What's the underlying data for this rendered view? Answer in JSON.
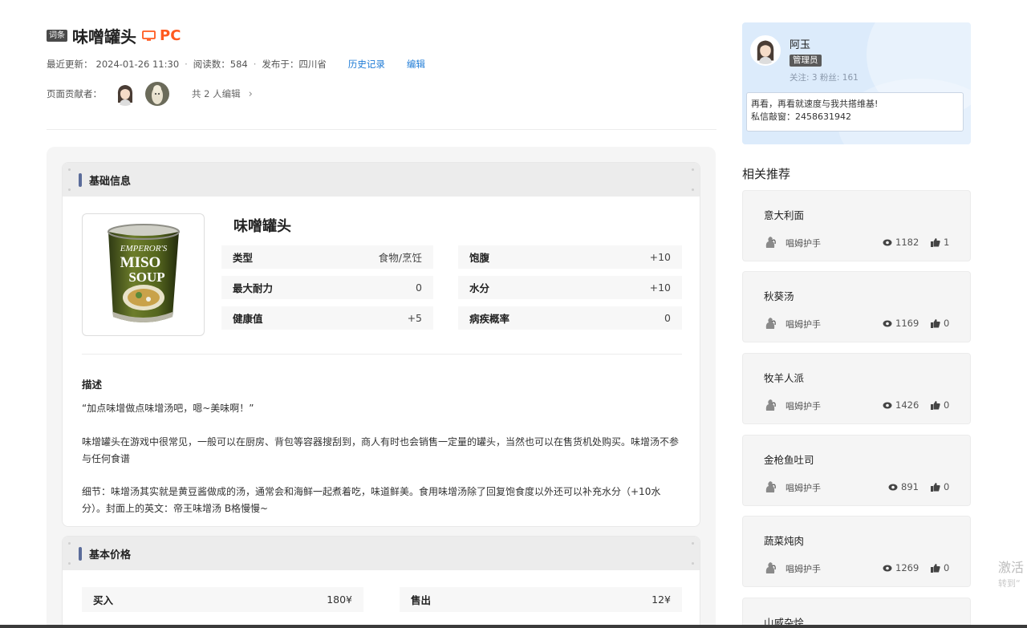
{
  "header": {
    "tag": "词条",
    "title": "味噌罐头",
    "platform": "PC",
    "last_updated_label": "最近更新：",
    "last_updated": "2024-01-26 11:30",
    "reads_label": "阅读数：",
    "reads": "584",
    "published_label": "发布于：",
    "published": "四川省",
    "history_link": "历史记录",
    "edit_link": "编辑",
    "contributors_label": "页面贡献者：",
    "editors_count": "共 2 人编辑",
    "chevron": "›"
  },
  "basic_info": {
    "section_title": "基础信息",
    "item_name": "味噌罐头",
    "stats": [
      {
        "key": "类型",
        "value": "食物/烹饪"
      },
      {
        "key": "饱腹",
        "value": "+10"
      },
      {
        "key": "最大耐力",
        "value": "0"
      },
      {
        "key": "水分",
        "value": "+10"
      },
      {
        "key": "健康值",
        "value": "+5"
      },
      {
        "key": "病疾概率",
        "value": "0"
      }
    ],
    "description_title": "描述",
    "paragraphs": [
      "“加点味增做点味增汤吧，嗯~美味啊！”",
      "味增罐头在游戏中很常见，一般可以在厨房、背包等容器搜刮到，商人有时也会销售一定量的罐头，当然也可以在售货机处购买。味增汤不参与任何食谱",
      "细节：味增汤其实就是黄豆酱做成的汤，通常会和海鲜一起煮着吃，味道鲜美。食用味增汤除了回复饱食度以外还可以补充水分（+10水分）。封面上的英文：帝王味增汤 B格慢慢~"
    ],
    "image_text": {
      "line1": "EMPEROR'S",
      "line2": "MISO",
      "line3": "SOUP"
    }
  },
  "price": {
    "section_title": "基本价格",
    "buy_label": "买入",
    "buy_value": "180¥",
    "sell_label": "售出",
    "sell_value": "12¥"
  },
  "profile": {
    "name": "阿玉",
    "role": "管理员",
    "follow_stats": "关注: 3  粉丝: 161",
    "message_line1": "再看，再看就速度与我共搭维基!",
    "message_line2": "私信敲窗：2458631942"
  },
  "recommendations": {
    "title": "相关推荐",
    "items": [
      {
        "name": "意大利面",
        "author": "唱姆护手",
        "views": "1182",
        "likes": "1"
      },
      {
        "name": "秋葵汤",
        "author": "唱姆护手",
        "views": "1169",
        "likes": "0"
      },
      {
        "name": "牧羊人派",
        "author": "唱姆护手",
        "views": "1426",
        "likes": "0"
      },
      {
        "name": "金枪鱼吐司",
        "author": "唱姆护手",
        "views": "891",
        "likes": "0"
      },
      {
        "name": "蔬菜炖肉",
        "author": "唱姆护手",
        "views": "1269",
        "likes": "0"
      },
      {
        "name": "山威杂烩",
        "author": "",
        "views": "",
        "likes": ""
      }
    ]
  },
  "watermark": {
    "line1": "激活",
    "line2": "转到“"
  },
  "colors": {
    "accent_orange": "#ff5a1f",
    "link_blue": "#1e7bd6",
    "section_bar": "#5b6c9a",
    "profile_bg": "#dcebfb"
  }
}
